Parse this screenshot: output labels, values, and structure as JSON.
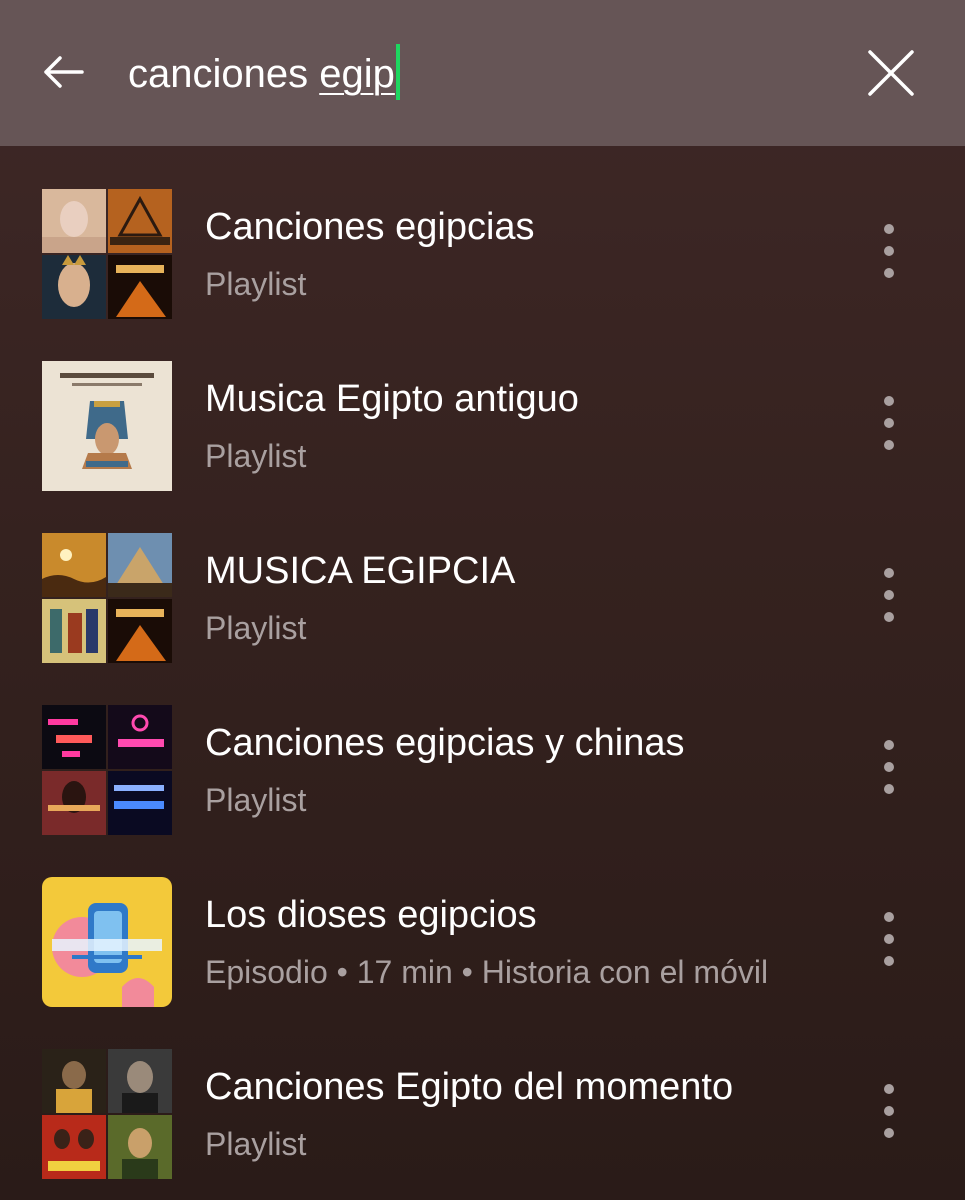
{
  "search": {
    "query_prefix": "canciones ",
    "query_underlined": "egip"
  },
  "results": [
    {
      "title": "Canciones egipcias",
      "subtitle": "Playlist"
    },
    {
      "title": "Musica Egipto antiguo",
      "subtitle": "Playlist"
    },
    {
      "title": "MUSICA EGIPCIA",
      "subtitle": "Playlist"
    },
    {
      "title": "Canciones egipcias y chinas",
      "subtitle": "Playlist"
    },
    {
      "title": "Los dioses egipcios",
      "subtitle": "Episodio • 17 min • Historia con el móvil"
    },
    {
      "title": "Canciones Egipto del momento",
      "subtitle": "Playlist"
    }
  ],
  "colors": {
    "search_bar": "#665556",
    "background_top": "#3f2827",
    "background_bottom": "#2a1b18",
    "caret": "#1ed760",
    "secondary_text": "#a9a0a0"
  },
  "icons": {
    "back": "arrow-left-icon",
    "clear": "close-icon",
    "more": "more-vertical-icon"
  }
}
